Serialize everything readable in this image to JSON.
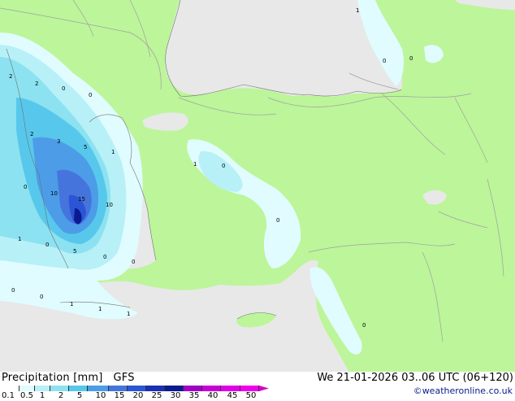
{
  "product": {
    "title": "Precipitation [mm]",
    "model": "GFS",
    "datetime": "We 21-01-2026 03..06 UTC (06+120)",
    "credit": "©weatheronline.co.uk"
  },
  "legend": {
    "ticks": [
      "0.1",
      "0.5",
      "1",
      "2",
      "5",
      "10",
      "15",
      "20",
      "25",
      "30",
      "35",
      "40",
      "45",
      "50"
    ],
    "colors": [
      "#ffffff",
      "#e0fcff",
      "#b8f0f8",
      "#8ce2f0",
      "#57c8ec",
      "#4d9ce8",
      "#4575dc",
      "#2a56d6",
      "#1a2fb3",
      "#0c1a90",
      "#a000c8",
      "#c800d8",
      "#e000e8",
      "#f000f0",
      "#d800c8"
    ]
  },
  "map_colors": {
    "land": "#bdf59a",
    "sea": "#e8e8e8",
    "border": "#a0a0a0"
  },
  "precip_labels": [
    {
      "text": "1"
    },
    {
      "text": "2"
    },
    {
      "text": "2"
    },
    {
      "text": "0"
    },
    {
      "text": "0"
    },
    {
      "text": "2"
    },
    {
      "text": "3"
    },
    {
      "text": "5"
    },
    {
      "text": "1"
    },
    {
      "text": "0"
    },
    {
      "text": "10"
    },
    {
      "text": "15"
    },
    {
      "text": "10"
    },
    {
      "text": "1"
    },
    {
      "text": "0"
    },
    {
      "text": "5"
    },
    {
      "text": "0"
    },
    {
      "text": "0"
    },
    {
      "text": "0"
    },
    {
      "text": "0"
    },
    {
      "text": "1"
    },
    {
      "text": "1"
    },
    {
      "text": "1"
    },
    {
      "text": "1"
    },
    {
      "text": "0"
    },
    {
      "text": "0"
    },
    {
      "text": "0"
    },
    {
      "text": "0"
    },
    {
      "text": "0"
    }
  ]
}
